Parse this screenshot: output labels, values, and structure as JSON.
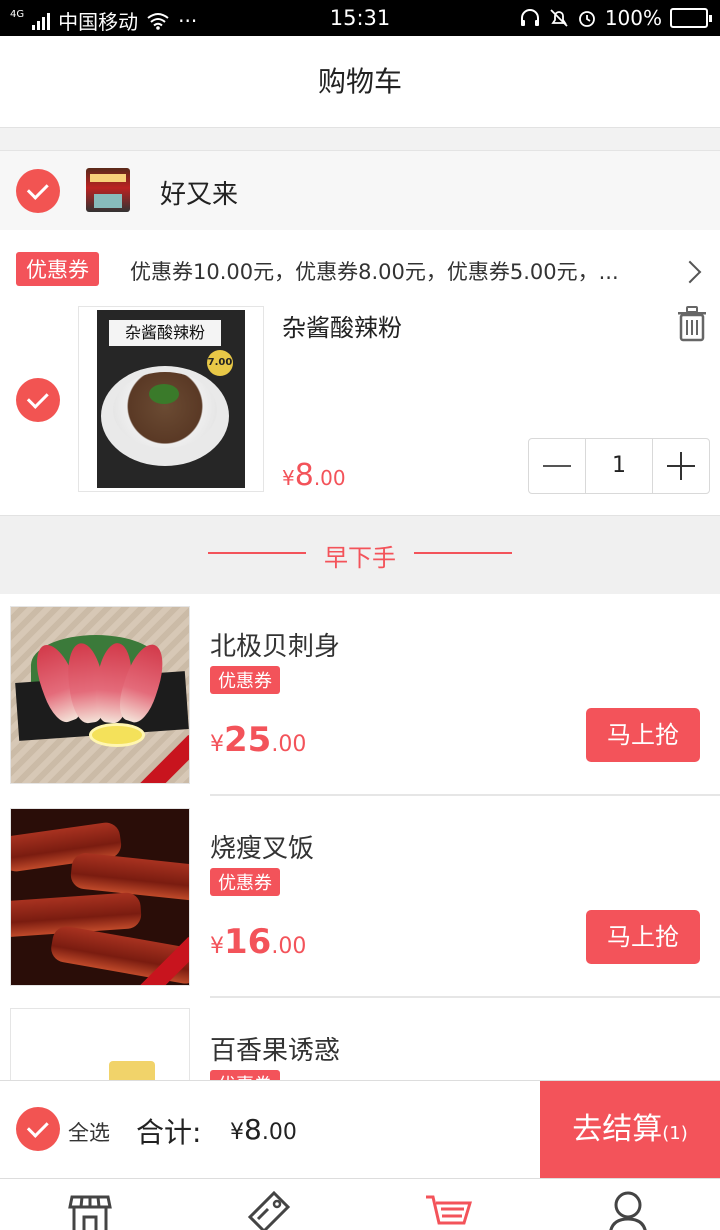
{
  "status_bar": {
    "network": "4G",
    "carrier": "中国移动",
    "more": "···",
    "time": "15:31",
    "battery": "100%"
  },
  "nav": {
    "title": "购物车"
  },
  "shop": {
    "name": "好又来",
    "coupon_tag": "优惠券",
    "coupon_text": "优惠券10.00元，优惠券8.00元，优惠券5.00元，..."
  },
  "cart_item": {
    "name": "杂酱酸辣粉",
    "price_symbol": "¥",
    "price_int": "8",
    "price_cents": ".00",
    "quantity": "1",
    "poster_label": "杂酱酸辣粉",
    "poster_price": "7.00"
  },
  "section": {
    "title": "早下手"
  },
  "recommendations": [
    {
      "title": "北极贝刺身",
      "tag": "优惠券",
      "price_symbol": "¥",
      "price_int": "25",
      "price_cents": ".00",
      "button": "马上抢"
    },
    {
      "title": "烧瘦叉饭",
      "tag": "优惠券",
      "price_symbol": "¥",
      "price_int": "16",
      "price_cents": ".00",
      "button": "马上抢"
    },
    {
      "title": "百香果诱惑",
      "tag": "优惠券"
    }
  ],
  "checkout": {
    "select_all": "全选",
    "total_label": "合计:",
    "total_symbol": "¥",
    "total_int": "8",
    "total_cents": ".00",
    "pay_label": "去结算",
    "pay_count": "(1)"
  },
  "colors": {
    "accent": "#f3535a",
    "background": "#f2f2f2"
  },
  "tab_icons": [
    "store-icon",
    "tag-icon",
    "cart-icon",
    "user-icon"
  ]
}
